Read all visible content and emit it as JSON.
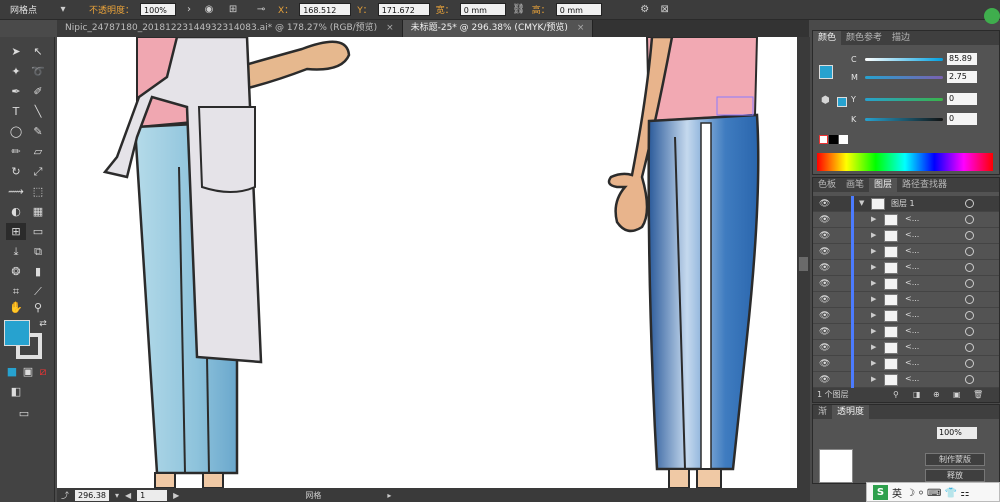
{
  "control_bar": {
    "mode_label": "网格点",
    "opacity_label": "不透明度：",
    "opacity_value": "100%",
    "x_label": "X：",
    "x_value": "168.512",
    "y_label": "Y：",
    "y_value": "171.672",
    "w_label": "宽：",
    "w_value": "0 mm",
    "h_label": "高：",
    "h_value": "0 mm"
  },
  "tabs": [
    {
      "label": "Nipic_24787180_20181223144932314083.ai* @ 178.27% (RGB/预览)",
      "active": false
    },
    {
      "label": "未标题-25* @ 296.38% (CMYK/预览)",
      "active": true
    }
  ],
  "tab_close": "×",
  "status": {
    "zoom": "296.38",
    "page": "1",
    "tool_name": "网格"
  },
  "color_panel": {
    "tabs": [
      "颜色",
      "颜色参考",
      "描边"
    ],
    "channels": [
      {
        "name": "C",
        "value": "85.89"
      },
      {
        "name": "M",
        "value": "2.75"
      },
      {
        "name": "Y",
        "value": "0"
      },
      {
        "name": "K",
        "value": "0"
      }
    ],
    "fill_color": "#27a2cf"
  },
  "layers_panel": {
    "tabs": [
      "色板",
      "画笔",
      "图层",
      "路径查找器"
    ],
    "parent_layer": "图层 1",
    "child_name": "<...",
    "row_count": 11,
    "footer": "1 个图层"
  },
  "gradient_panel": {
    "tabs": [
      "渐",
      "透明度"
    ],
    "opacity_value": "100%",
    "button_make_mask": "制作蒙版",
    "button_release": "释放"
  },
  "ime": {
    "lang": "英",
    "icons": "☽ ⸰ ⌨ 👕 ⚏"
  },
  "watermark": {
    "site": "jingyan.baidu.com",
    "brand": "经验"
  }
}
